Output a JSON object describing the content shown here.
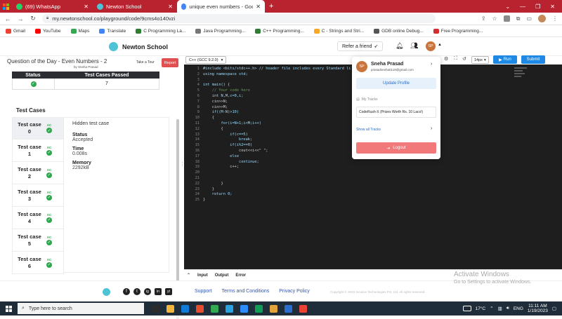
{
  "browser": {
    "tabs": [
      {
        "label": "(69) WhatsApp",
        "color": "#25d366"
      },
      {
        "label": "Newton School",
        "color": "#4ec3d6"
      },
      {
        "label": "unique even numbers - Google S",
        "color": "#4285f4"
      }
    ],
    "new_tab": "+",
    "url": "my.newtonschool.co/playground/code/9cms4o140vzi",
    "window_controls": {
      "minimize": "—",
      "restore": "❐",
      "close": "✕"
    },
    "bookmarks": [
      {
        "label": "Gmail",
        "color": "#ea4335"
      },
      {
        "label": "YouTube",
        "color": "#ff0000"
      },
      {
        "label": "Maps",
        "color": "#34a853"
      },
      {
        "label": "Translate",
        "color": "#4285f4"
      },
      {
        "label": "C Programming La...",
        "color": "#2e7d32"
      },
      {
        "label": "Java Programming...",
        "color": "#777"
      },
      {
        "label": "C++ Programming...",
        "color": "#2e7d32"
      },
      {
        "label": "C - Strings and Stri...",
        "color": "#f9a825"
      },
      {
        "label": "GDB online Debug...",
        "color": "#555"
      },
      {
        "label": "Free Programming...",
        "color": "#d32f2f"
      }
    ]
  },
  "app": {
    "brand": "Newton School",
    "refer_label": "Refer a friend",
    "avatar_initials": "SP",
    "question_title": "Question of the Day - Even Numbers - 2",
    "question_by": "by Sneha Prasad",
    "take_tour": "Take a Tour",
    "report": "Report",
    "language": "C++ (GCC 9.2.0)",
    "font_size": "14px",
    "run": "Run",
    "submit": "Submit"
  },
  "results": {
    "headers": [
      "Status",
      "Test Cases Passed"
    ],
    "passed": "7"
  },
  "test_cases": {
    "title": "Test Cases",
    "items": [
      {
        "label": "Test case",
        "num": "0"
      },
      {
        "label": "Test case",
        "num": "1"
      },
      {
        "label": "Test case",
        "num": "2"
      },
      {
        "label": "Test case",
        "num": "3"
      },
      {
        "label": "Test case",
        "num": "4"
      },
      {
        "label": "Test case",
        "num": "5"
      },
      {
        "label": "Test case",
        "num": "6"
      }
    ],
    "badge": "AC",
    "detail": {
      "heading": "Hidden test case",
      "status_label": "Status",
      "status_value": "Accepted",
      "time_label": "Time",
      "time_value": "0.008s",
      "memory_label": "Memory",
      "memory_value": "2292kB"
    }
  },
  "editor": {
    "lines": [
      "#include <bits/stdc++.h> // header file includes every Standard li",
      "using namespace std;",
      "",
      "int main() {",
      "    // Your code here",
      "    int N,M,c=0,i;",
      "    cin>>N;",
      "    cin>>M;",
      "    if((M-N)>10)",
      "    {",
      "        for(i=N+1;i<M;i++)",
      "        {",
      "            if(c==5)",
      "                break;",
      "            if(i%2==0)",
      "                cout<<i<<\" \";",
      "            else",
      "                continue;",
      "            c++;",
      "",
      "",
      "        }",
      "    }",
      "    return 0;",
      "}"
    ]
  },
  "console_tabs": [
    "Input",
    "Output",
    "Error"
  ],
  "profile_menu": {
    "name": "Sneha Prasad",
    "email": "prasadsneha0119@gmail.com",
    "update_profile": "Update Profile",
    "my_tracks": "My Tracks",
    "track": "CodeRush-X (Prizes Worth Rs. 10 Lacs!)",
    "show_all": "Show all Tracks",
    "logout": "Logout"
  },
  "footer": {
    "links": [
      "Support",
      "Terms and Conditions",
      "Privacy Policy"
    ],
    "copyright": "Copyright © 2023 Incanus Technologies Pvt. Ltd. All rights reserved.",
    "social": [
      "f",
      "t",
      "ig",
      "in",
      "yt"
    ]
  },
  "watermark": {
    "title": "Activate Windows",
    "subtitle": "Go to Settings to activate Windows."
  },
  "taskbar": {
    "search_placeholder": "Type here to search",
    "temperature": "17°C",
    "language": "ENG",
    "time": "11:11 AM",
    "date": "1/19/2023",
    "apps": [
      "#2c2c2c",
      "#f0b73c",
      "#0f7bd6",
      "#e54d2e",
      "#34a853",
      "#2aa3e0",
      "#2d8cff",
      "#0f9d58",
      "#e2a33a",
      "#2a6fcf",
      "#ea4335"
    ]
  },
  "colors": {
    "chrome_red": "#b8232f",
    "run_blue": "#1e88e5",
    "report_red": "#e05050",
    "logout_pink": "#f27979",
    "accepted_green": "#2ea84e"
  }
}
